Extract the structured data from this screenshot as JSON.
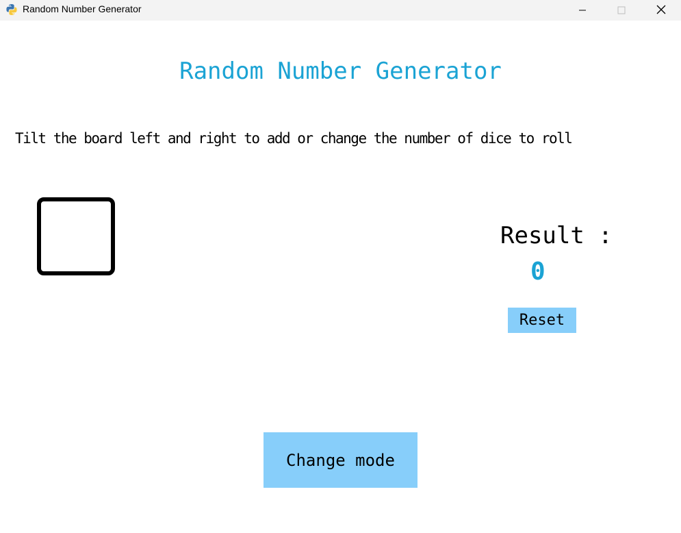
{
  "window": {
    "title": "Random Number Generator",
    "app_icon": "python-icon",
    "controls": [
      "minimize-icon",
      "maximize-icon",
      "close-icon"
    ]
  },
  "main": {
    "heading": "Random Number Generator",
    "instructions": "Tilt the board left and right to add or change the number of dice to roll",
    "die_face": "",
    "result_label": "Result :",
    "result_value": "0",
    "reset_label": "Reset",
    "change_mode_label": "Change mode"
  },
  "colors": {
    "accent_text": "#1ba3d4",
    "button_background": "#87cefa",
    "titlebar": "#f3f3f3",
    "background": "#ffffff"
  }
}
